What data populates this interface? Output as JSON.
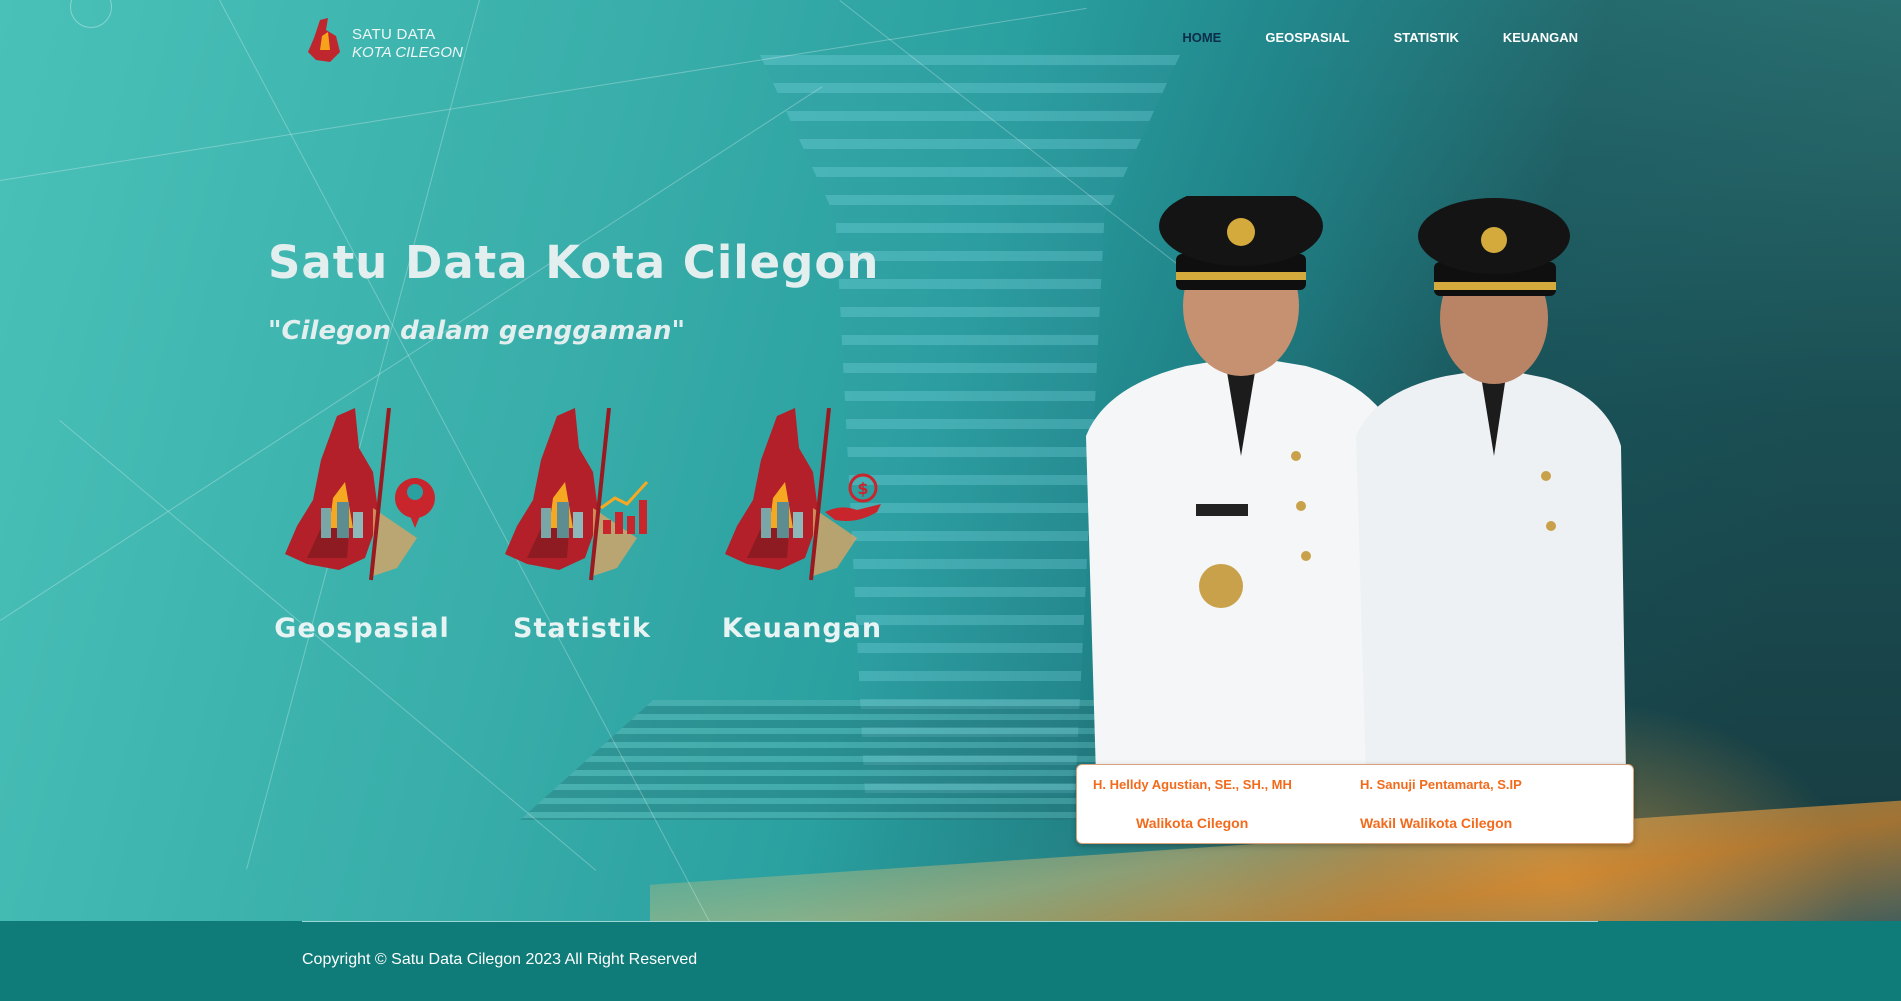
{
  "header": {
    "logo_line1": "SATU DATA",
    "logo_line2": "KOTA CILEGON",
    "nav": [
      {
        "label": "HOME",
        "active": true
      },
      {
        "label": "GEOSPASIAL",
        "active": false
      },
      {
        "label": "STATISTIK",
        "active": false
      },
      {
        "label": "KEUANGAN",
        "active": false
      }
    ]
  },
  "hero": {
    "title": "Satu Data Kota Cilegon",
    "tagline": "\"Cilegon dalam genggaman\"",
    "categories": [
      {
        "label": "Geospasial",
        "icon": "map-pin-icon"
      },
      {
        "label": "Statistik",
        "icon": "bar-chart-icon"
      },
      {
        "label": "Keuangan",
        "icon": "money-hand-icon"
      }
    ]
  },
  "leaders": {
    "mayor_name": "H. Helldy Agustian, SE., SH., MH",
    "mayor_role": "Walikota Cilegon",
    "deputy_name": "H. Sanuji Pentamarta, S.IP",
    "deputy_role": "Wakil Walikota Cilegon"
  },
  "footer": {
    "copyright": "Copyright © Satu Data Cilegon 2023 All Right Reserved"
  },
  "colors": {
    "accent_orange": "#f26b1d",
    "footer_teal": "#0f7c79",
    "nav_active": "#0b2d4a",
    "map_red": "#b3202a"
  }
}
